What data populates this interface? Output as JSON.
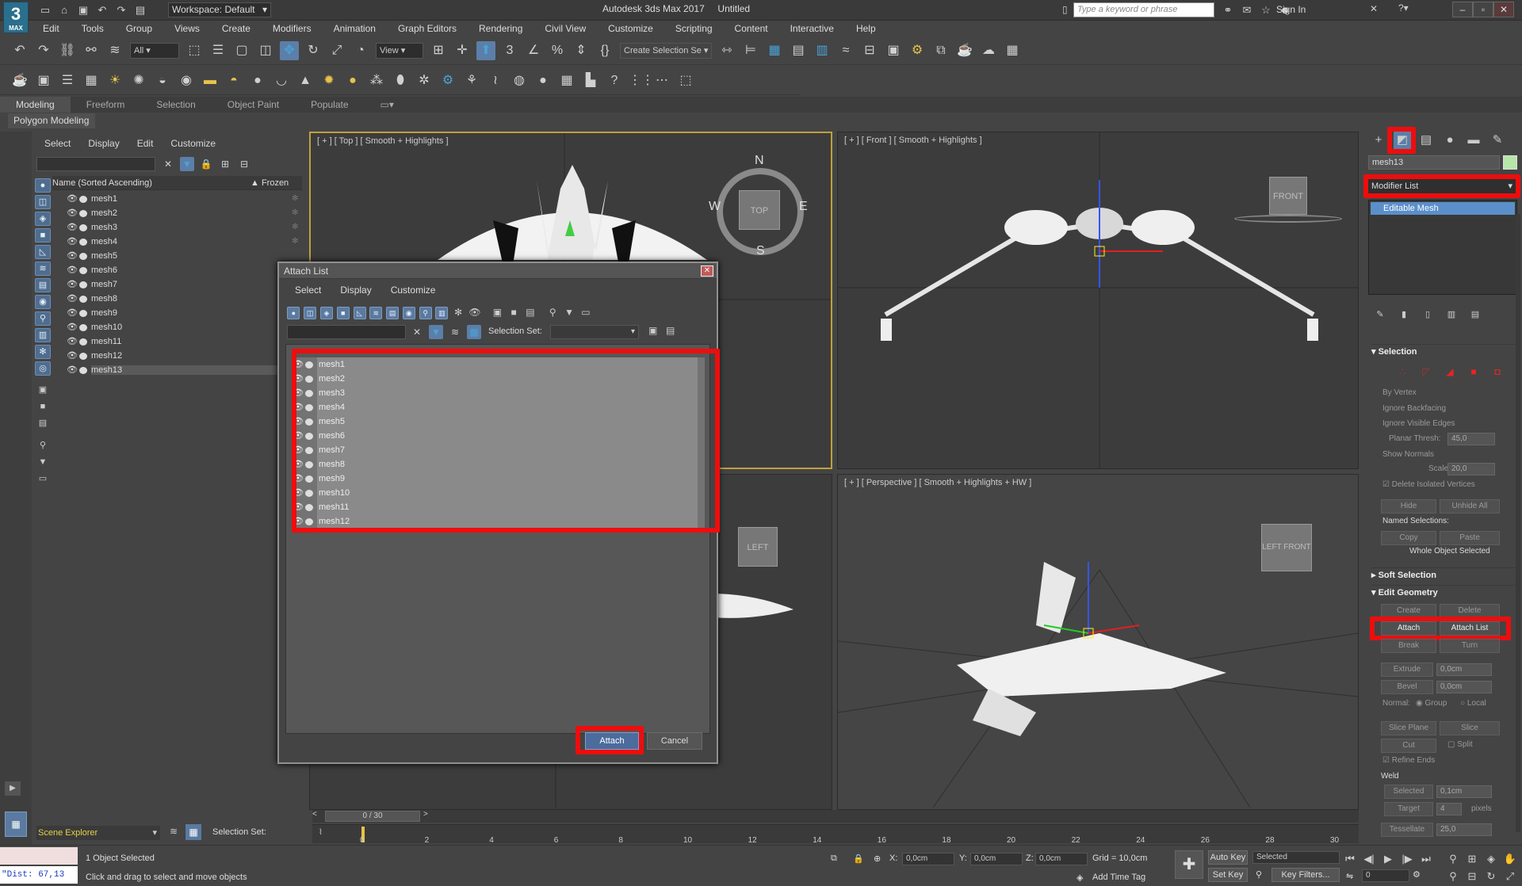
{
  "app": {
    "logo": "3",
    "logo_sub": "MAX",
    "title": "Autodesk 3ds Max 2017",
    "doc": "Untitled",
    "workspace": "Workspace: Default",
    "search_placeholder": "Type a keyword or phrase",
    "signin": "Sign In"
  },
  "menu": [
    "Edit",
    "Tools",
    "Group",
    "Views",
    "Create",
    "Modifiers",
    "Animation",
    "Graph Editors",
    "Rendering",
    "Civil View",
    "Customize",
    "Scripting",
    "Content",
    "Interactive",
    "Help"
  ],
  "toolbar": {
    "filter_value": "All",
    "view_value": "View",
    "selection_set_value": "Create Selection Se"
  },
  "ribbon": {
    "tabs": [
      "Modeling",
      "Freeform",
      "Selection",
      "Object Paint",
      "Populate"
    ],
    "active": "Modeling",
    "panel": "Polygon Modeling"
  },
  "scene_explorer": {
    "menu": [
      "Select",
      "Display",
      "Edit",
      "Customize"
    ],
    "column_name": "Name (Sorted Ascending)",
    "column_frozen": "▲ Frozen",
    "items": [
      "mesh1",
      "mesh2",
      "mesh3",
      "mesh4",
      "mesh5",
      "mesh6",
      "mesh7",
      "mesh8",
      "mesh9",
      "mesh10",
      "mesh11",
      "mesh12",
      "mesh13"
    ],
    "selected": "mesh13",
    "footer_label": "Scene Explorer",
    "selection_set_label": "Selection Set:"
  },
  "viewports": {
    "top": "[ + ] [ Top ] [ Smooth + Highlights ]",
    "front": "[ + ] [ Front ] [ Smooth + Highlights ]",
    "perspective": "[ + ] [ Perspective ] [ Smooth + Highlights + HW ]",
    "cube_top": "TOP",
    "cube_front": "FRONT",
    "cube_left": "LEFT",
    "cube_persp_left": "LEFT",
    "cube_persp_front": "FRONT",
    "compass_n": "N",
    "compass_s": "S",
    "compass_e": "E",
    "compass_w": "W"
  },
  "dialog": {
    "title": "Attach List",
    "close": "✕",
    "menu": [
      "Select",
      "Display",
      "Customize"
    ],
    "selection_set_label": "Selection Set:",
    "items": [
      "mesh1",
      "mesh2",
      "mesh3",
      "mesh4",
      "mesh5",
      "mesh6",
      "mesh7",
      "mesh8",
      "mesh9",
      "mesh10",
      "mesh11",
      "mesh12"
    ],
    "attach": "Attach",
    "cancel": "Cancel"
  },
  "command_panel": {
    "object_name": "mesh13",
    "modifier_list": "Modifier List",
    "stack_item": "Editable Mesh",
    "selection": {
      "title": "Selection",
      "by_vertex": "By Vertex",
      "ignore_backfacing": "Ignore Backfacing",
      "ignore_visible_edges": "Ignore Visible Edges",
      "planar_thresh_label": "Planar Thresh:",
      "planar_thresh_value": "45,0",
      "show_normals": "Show Normals",
      "scale_label": "Scale:",
      "scale_value": "20,0",
      "delete_isolated": "Delete Isolated Vertices",
      "hide": "Hide",
      "unhide_all": "Unhide All",
      "named_selections": "Named Selections:",
      "copy": "Copy",
      "paste": "Paste",
      "whole_object": "Whole Object Selected"
    },
    "soft_selection": "Soft Selection",
    "edit_geometry": {
      "title": "Edit Geometry",
      "create": "Create",
      "delete": "Delete",
      "attach": "Attach",
      "attach_list": "Attach List",
      "break": "Break",
      "turn": "Turn",
      "extrude": "Extrude",
      "extrude_value": "0,0cm",
      "bevel": "Bevel",
      "bevel_value": "0,0cm",
      "normal_label": "Normal:",
      "group": "Group",
      "local": "Local",
      "slice_plane": "Slice Plane",
      "slice": "Slice",
      "cut": "Cut",
      "split": "Split",
      "refine_ends": "Refine Ends",
      "weld": "Weld",
      "selected": "Selected",
      "selected_value": "0,1cm",
      "target": "Target",
      "target_value": "4",
      "pixels": "pixels",
      "tessellate": "Tessellate",
      "tessellate_value": "25,0"
    }
  },
  "timeline": {
    "frame": "0 / 30",
    "ticks": [
      "0",
      "2",
      "4",
      "6",
      "8",
      "10",
      "12",
      "14",
      "16",
      "18",
      "20",
      "22",
      "24",
      "26",
      "28",
      "30"
    ]
  },
  "status": {
    "maxscript": "\"Dist: 67,13",
    "objects": "1 Object Selected",
    "hint": "Click and drag to select and move objects",
    "x_label": "X:",
    "x": "0,0cm",
    "y_label": "Y:",
    "y": "0,0cm",
    "z_label": "Z:",
    "z": "0,0cm",
    "grid": "Grid = 10,0cm",
    "add_time_tag": "Add Time Tag",
    "auto_key": "Auto Key",
    "set_key": "Set Key",
    "selected": "Selected",
    "key_filters": "Key Filters...",
    "frame_value": "0"
  },
  "colors": {
    "highlight": "#ee0d0d",
    "accent": "#5b8fc9",
    "background": "#444444"
  }
}
